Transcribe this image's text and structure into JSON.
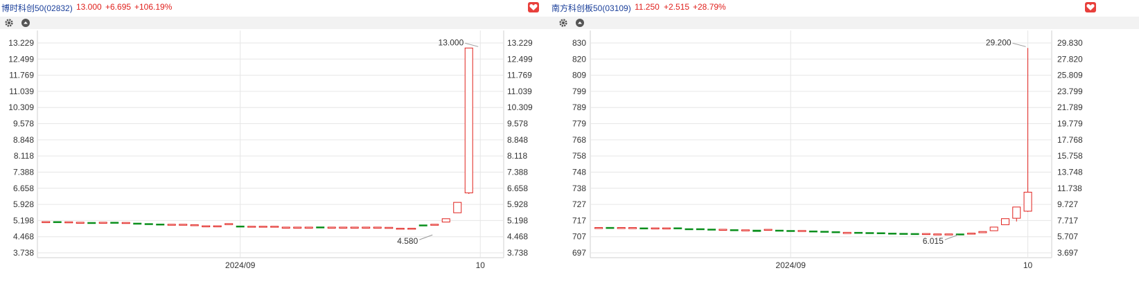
{
  "colors": {
    "up": "#e0201c",
    "down": "#0a8f1c",
    "grid": "#e6e6e6",
    "label": "#333333",
    "name": "#1a3f9a"
  },
  "chart_data": [
    {
      "type": "candlestick",
      "name": "博时科创50(02832)",
      "price": "13.000",
      "change": "+6.695",
      "change_pct": "+106.19%",
      "y_ticks": [
        "13.229",
        "12.499",
        "11.769",
        "11.039",
        "10.309",
        "9.578",
        "8.848",
        "8.118",
        "7.388",
        "6.658",
        "5.928",
        "5.198",
        "4.468",
        "3.738"
      ],
      "ylim": [
        3.738,
        13.229
      ],
      "x_labels": [
        {
          "index": 17,
          "text": "2024/09"
        },
        {
          "index": 38,
          "text": "10"
        }
      ],
      "annotations": [
        {
          "index": 38,
          "value": 13.0,
          "text": "13.000"
        },
        {
          "index": 34,
          "value": 4.58,
          "text": "4.580"
        }
      ],
      "candles": [
        {
          "o": 5.15,
          "c": 5.15,
          "h": 5.15,
          "l": 5.15
        },
        {
          "o": 5.15,
          "c": 5.14,
          "h": 5.15,
          "l": 5.14
        },
        {
          "o": 5.12,
          "c": 5.14,
          "h": 5.14,
          "l": 5.12
        },
        {
          "o": 5.12,
          "c": 5.12,
          "h": 5.12,
          "l": 5.12
        },
        {
          "o": 5.11,
          "c": 5.1,
          "h": 5.11,
          "l": 5.1
        },
        {
          "o": 5.11,
          "c": 5.12,
          "h": 5.12,
          "l": 5.11
        },
        {
          "o": 5.12,
          "c": 5.11,
          "h": 5.12,
          "l": 5.11
        },
        {
          "o": 5.11,
          "c": 5.11,
          "h": 5.11,
          "l": 5.11
        },
        {
          "o": 5.08,
          "c": 5.06,
          "h": 5.08,
          "l": 5.06
        },
        {
          "o": 5.06,
          "c": 5.05,
          "h": 5.06,
          "l": 5.05
        },
        {
          "o": 5.04,
          "c": 5.03,
          "h": 5.04,
          "l": 5.03
        },
        {
          "o": 5.03,
          "c": 5.03,
          "h": 5.03,
          "l": 5.03
        },
        {
          "o": 5.01,
          "c": 5.03,
          "h": 5.03,
          "l": 5.01
        },
        {
          "o": 5.0,
          "c": 5.01,
          "h": 5.01,
          "l": 5.0
        },
        {
          "o": 4.96,
          "c": 4.96,
          "h": 4.96,
          "l": 4.96
        },
        {
          "o": 4.96,
          "c": 4.96,
          "h": 4.96,
          "l": 4.96
        },
        {
          "o": 5.05,
          "c": 5.06,
          "h": 5.06,
          "l": 5.05
        },
        {
          "o": 4.95,
          "c": 4.94,
          "h": 4.95,
          "l": 4.94
        },
        {
          "o": 4.94,
          "c": 4.94,
          "h": 4.94,
          "l": 4.94
        },
        {
          "o": 4.94,
          "c": 4.94,
          "h": 4.94,
          "l": 4.94
        },
        {
          "o": 4.94,
          "c": 4.94,
          "h": 4.94,
          "l": 4.94
        },
        {
          "o": 4.9,
          "c": 4.9,
          "h": 4.9,
          "l": 4.9
        },
        {
          "o": 4.9,
          "c": 4.9,
          "h": 4.9,
          "l": 4.9
        },
        {
          "o": 4.9,
          "c": 4.9,
          "h": 4.9,
          "l": 4.9
        },
        {
          "o": 4.91,
          "c": 4.9,
          "h": 4.91,
          "l": 4.9
        },
        {
          "o": 4.9,
          "c": 4.9,
          "h": 4.9,
          "l": 4.9
        },
        {
          "o": 4.9,
          "c": 4.9,
          "h": 4.9,
          "l": 4.9
        },
        {
          "o": 4.9,
          "c": 4.9,
          "h": 4.9,
          "l": 4.9
        },
        {
          "o": 4.9,
          "c": 4.9,
          "h": 4.9,
          "l": 4.9
        },
        {
          "o": 4.9,
          "c": 4.9,
          "h": 4.9,
          "l": 4.9
        },
        {
          "o": 4.86,
          "c": 4.89,
          "h": 4.89,
          "l": 4.86
        },
        {
          "o": 4.85,
          "c": 4.85,
          "h": 4.85,
          "l": 4.85
        },
        {
          "o": 4.85,
          "c": 4.85,
          "h": 4.85,
          "l": 4.85
        },
        {
          "o": 5.0,
          "c": 4.98,
          "h": 5.0,
          "l": 4.98
        },
        {
          "o": 5.02,
          "c": 5.03,
          "h": 5.03,
          "l": 5.02
        },
        {
          "o": 5.13,
          "c": 5.28,
          "h": 5.28,
          "l": 5.13
        },
        {
          "o": 5.55,
          "c": 6.02,
          "h": 6.02,
          "l": 5.55
        },
        {
          "o": 6.45,
          "c": 13.0,
          "h": 13.0,
          "l": 6.4
        }
      ]
    },
    {
      "type": "candlestick",
      "name": "南方科创板50(03109)",
      "price": "11.250",
      "change": "+2.515",
      "change_pct": "+28.79%",
      "y_ticks": [
        "29.830",
        "27.820",
        "25.809",
        "23.799",
        "21.789",
        "19.779",
        "17.768",
        "15.758",
        "13.748",
        "11.738",
        "9.727",
        "7.717",
        "5.707",
        "3.697"
      ],
      "ylim": [
        3.697,
        29.83
      ],
      "x_labels": [
        {
          "index": 17,
          "text": "2024/09"
        },
        {
          "index": 38,
          "text": "10"
        }
      ],
      "annotations": [
        {
          "index": 38,
          "value": 29.2,
          "text": "29.200"
        },
        {
          "index": 32,
          "value": 6.015,
          "text": "6.015"
        }
      ],
      "candles": [
        {
          "o": 6.85,
          "c": 6.85,
          "h": 6.85,
          "l": 6.85
        },
        {
          "o": 6.86,
          "c": 6.85,
          "h": 6.86,
          "l": 6.85
        },
        {
          "o": 6.84,
          "c": 6.85,
          "h": 6.85,
          "l": 6.84
        },
        {
          "o": 6.84,
          "c": 6.84,
          "h": 6.84,
          "l": 6.84
        },
        {
          "o": 6.8,
          "c": 6.78,
          "h": 6.8,
          "l": 6.78
        },
        {
          "o": 6.78,
          "c": 6.8,
          "h": 6.8,
          "l": 6.78
        },
        {
          "o": 6.8,
          "c": 6.8,
          "h": 6.8,
          "l": 6.8
        },
        {
          "o": 6.81,
          "c": 6.79,
          "h": 6.81,
          "l": 6.79
        },
        {
          "o": 6.7,
          "c": 6.66,
          "h": 6.7,
          "l": 6.66
        },
        {
          "o": 6.7,
          "c": 6.69,
          "h": 6.7,
          "l": 6.69
        },
        {
          "o": 6.65,
          "c": 6.63,
          "h": 6.65,
          "l": 6.63
        },
        {
          "o": 6.6,
          "c": 6.63,
          "h": 6.63,
          "l": 6.6
        },
        {
          "o": 6.58,
          "c": 6.55,
          "h": 6.58,
          "l": 6.55
        },
        {
          "o": 6.52,
          "c": 6.56,
          "h": 6.56,
          "l": 6.52
        },
        {
          "o": 6.52,
          "c": 6.36,
          "h": 6.52,
          "l": 6.36
        },
        {
          "o": 6.58,
          "c": 6.62,
          "h": 6.62,
          "l": 6.58
        },
        {
          "o": 6.52,
          "c": 6.48,
          "h": 6.52,
          "l": 6.48
        },
        {
          "o": 6.48,
          "c": 6.47,
          "h": 6.48,
          "l": 6.47
        },
        {
          "o": 6.4,
          "c": 6.48,
          "h": 6.48,
          "l": 6.4
        },
        {
          "o": 6.42,
          "c": 6.4,
          "h": 6.42,
          "l": 6.4
        },
        {
          "o": 6.38,
          "c": 6.35,
          "h": 6.38,
          "l": 6.35
        },
        {
          "o": 6.33,
          "c": 6.3,
          "h": 6.33,
          "l": 6.3
        },
        {
          "o": 6.1,
          "c": 6.25,
          "h": 6.25,
          "l": 6.1
        },
        {
          "o": 6.25,
          "c": 6.2,
          "h": 6.25,
          "l": 6.2
        },
        {
          "o": 6.22,
          "c": 6.2,
          "h": 6.22,
          "l": 6.2
        },
        {
          "o": 6.2,
          "c": 6.18,
          "h": 6.2,
          "l": 6.18
        },
        {
          "o": 6.15,
          "c": 6.12,
          "h": 6.15,
          "l": 6.12
        },
        {
          "o": 6.12,
          "c": 6.1,
          "h": 6.12,
          "l": 6.1
        },
        {
          "o": 6.1,
          "c": 6.08,
          "h": 6.1,
          "l": 6.08
        },
        {
          "o": 6.05,
          "c": 6.1,
          "h": 6.1,
          "l": 6.05
        },
        {
          "o": 6.05,
          "c": 6.05,
          "h": 6.05,
          "l": 6.05
        },
        {
          "o": 6.02,
          "c": 6.05,
          "h": 6.05,
          "l": 6.02
        },
        {
          "o": 6.05,
          "c": 6.03,
          "h": 6.05,
          "l": 6.015
        },
        {
          "o": 6.05,
          "c": 6.15,
          "h": 6.15,
          "l": 6.05
        },
        {
          "o": 6.2,
          "c": 6.35,
          "h": 6.35,
          "l": 6.2
        },
        {
          "o": 6.45,
          "c": 6.9,
          "h": 6.9,
          "l": 6.45
        },
        {
          "o": 7.2,
          "c": 7.95,
          "h": 7.95,
          "l": 7.2
        },
        {
          "o": 8.0,
          "c": 9.4,
          "h": 9.4,
          "l": 7.6
        },
        {
          "o": 8.88,
          "c": 11.25,
          "h": 29.2,
          "l": 8.8
        }
      ]
    }
  ]
}
